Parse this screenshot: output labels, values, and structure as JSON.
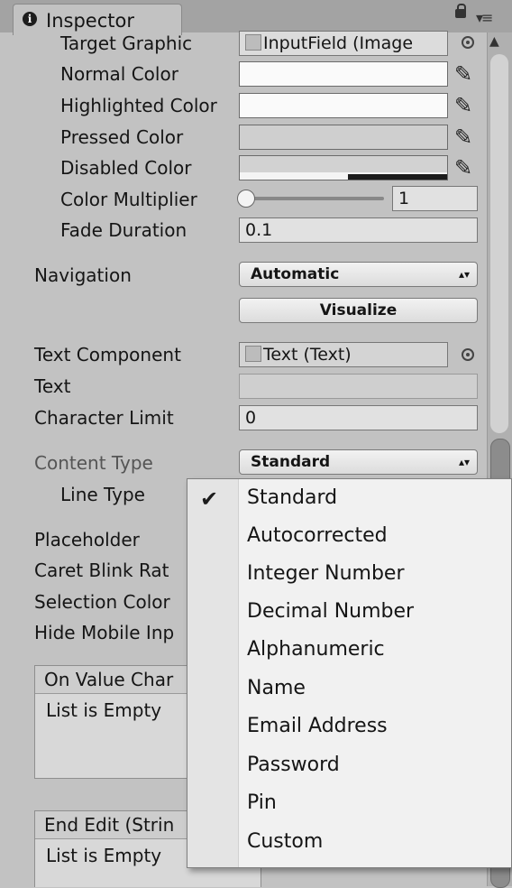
{
  "window": {
    "tab_title": "Inspector"
  },
  "transition": {
    "target_graphic_label": "Target Graphic",
    "target_graphic_value": "InputField (Image",
    "normal_color_label": "Normal Color",
    "highlighted_color_label": "Highlighted Color",
    "pressed_color_label": "Pressed Color",
    "disabled_color_label": "Disabled Color",
    "color_multiplier_label": "Color Multiplier",
    "color_multiplier_value": "1",
    "fade_duration_label": "Fade Duration",
    "fade_duration_value": "0.1"
  },
  "navigation": {
    "label": "Navigation",
    "value": "Automatic",
    "visualize_label": "Visualize"
  },
  "input": {
    "text_component_label": "Text Component",
    "text_component_value": "Text (Text)",
    "text_label": "Text",
    "text_value": "",
    "character_limit_label": "Character Limit",
    "character_limit_value": "0",
    "content_type_label": "Content Type",
    "content_type_value": "Standard",
    "line_type_label": "Line Type",
    "placeholder_label": "Placeholder",
    "caret_blink_label": "Caret Blink Rat",
    "selection_color_label": "Selection Color",
    "hide_mobile_label": "Hide Mobile Inp"
  },
  "events": {
    "on_value_changed_title": "On Value Char",
    "on_value_changed_body": "List is Empty",
    "end_edit_title": "End Edit (Strin",
    "end_edit_body": "List is Empty"
  },
  "content_type_menu": {
    "selected": "Standard",
    "options": [
      "Standard",
      "Autocorrected",
      "Integer Number",
      "Decimal Number",
      "Alphanumeric",
      "Name",
      "Email Address",
      "Password",
      "Pin",
      "Custom"
    ]
  }
}
